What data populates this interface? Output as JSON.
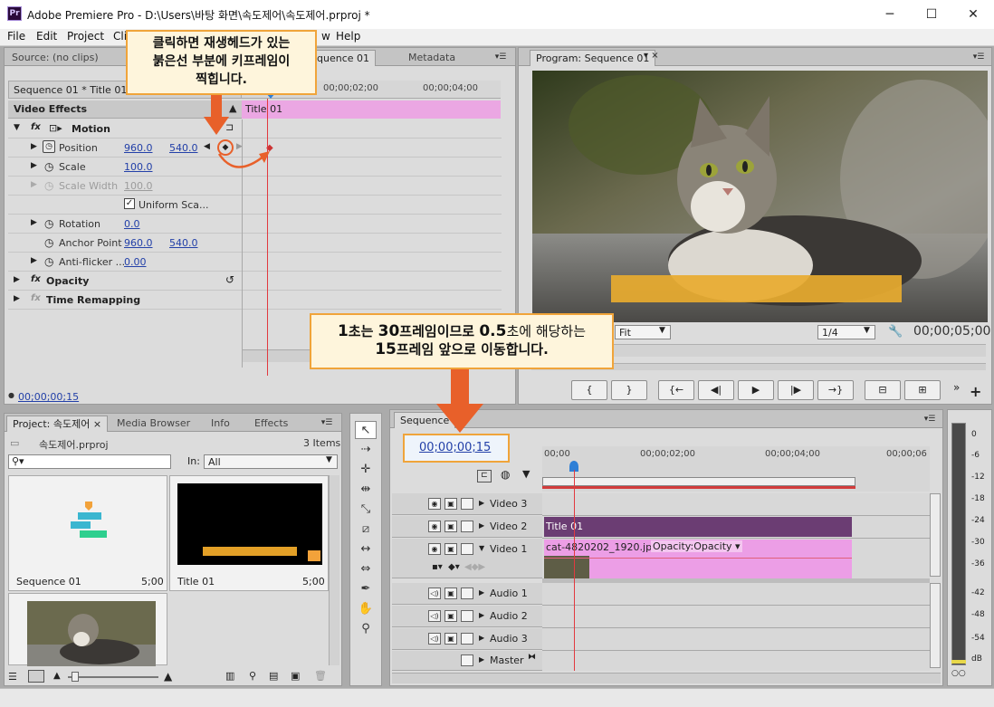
{
  "window": {
    "title": "Adobe Premiere Pro - D:\\Users\\바탕 화면\\속도제어\\속도제어.prproj *",
    "icon_text": "Pr",
    "minimize": "─",
    "maximize": "☐",
    "close": "✕"
  },
  "menu": [
    "File",
    "Edit",
    "Project",
    "Cli",
    "w",
    "Help"
  ],
  "source_panel": {
    "tabs": [
      "Source: (no clips)",
      "quence 01",
      "Metadata"
    ],
    "sequence_label": "Sequence 01 * Title 01",
    "ruler_ticks": [
      "00;00;02;00",
      "00;00;04;00"
    ],
    "clip_label": "Title 01",
    "section_title": "Video Effects",
    "effects": {
      "motion": {
        "label": "Motion"
      },
      "position": {
        "label": "Position",
        "x": "960.0",
        "y": "540.0"
      },
      "scale": {
        "label": "Scale",
        "value": "100.0"
      },
      "scale_width": {
        "label": "Scale Width",
        "value": "100.0"
      },
      "uniform_scale": {
        "label": "Uniform Sca..."
      },
      "rotation": {
        "label": "Rotation",
        "value": "0.0"
      },
      "anchor_point": {
        "label": "Anchor Point",
        "x": "960.0",
        "y": "540.0"
      },
      "anti_flicker": {
        "label": "Anti-flicker ...",
        "value": "0.00"
      },
      "opacity": {
        "label": "Opacity"
      },
      "time_remapping": {
        "label": "Time Remapping"
      }
    },
    "footer_time": "00;00;00;15"
  },
  "program_panel": {
    "tab": "Program: Sequence 01",
    "fit": "Fit",
    "resolution": "1/4",
    "timecode": "00;00;05;00",
    "transport": [
      "{",
      "}",
      "{←",
      "◀|",
      "▶",
      "|▶",
      "→}",
      "⊟",
      "⊞"
    ],
    "add": "+"
  },
  "project_panel": {
    "tabs": [
      "Project: 속도제어 ×",
      "Media Browser",
      "Info",
      "Effects"
    ],
    "file_name": "속도제어.prproj",
    "items_count": "3 Items",
    "in_label": "In:",
    "in_value": "All",
    "items": [
      {
        "name": "Sequence 01",
        "duration": "5;00"
      },
      {
        "name": "Title 01",
        "duration": "5;00"
      }
    ]
  },
  "timeline_panel": {
    "tab": "Sequence",
    "timecode": "00;00;00;15",
    "ruler_ticks": [
      "00;00",
      "00;00;02;00",
      "00;00;04;00",
      "00;00;06"
    ],
    "tracks": [
      {
        "name": "Video 3"
      },
      {
        "name": "Video 2"
      },
      {
        "name": "Video 1"
      },
      {
        "name": "Audio 1"
      },
      {
        "name": "Audio 2"
      },
      {
        "name": "Audio 3"
      },
      {
        "name": "Master"
      }
    ],
    "clip_title": "Title 01",
    "clip_image": "cat-4820202_1920.jpg",
    "clip_fx": "Opacity:Opacity ▾"
  },
  "meter_labels": [
    "0",
    "-6",
    "-12",
    "-18",
    "-24",
    "-30",
    "-36",
    "-42",
    "-48",
    "-54",
    "dB"
  ],
  "callouts": {
    "top": [
      "클릭하면 재생헤드가 있는",
      "붉은선 부분에 키프레임이",
      "찍힙니다."
    ],
    "middle_parts": [
      "1",
      "초는 ",
      "30",
      "프레임이므로 ",
      "0.5",
      "초에 해당하는"
    ],
    "middle_line2_parts": [
      "15",
      "프레임 앞으로 이동합니다."
    ]
  },
  "colors": {
    "accent_blue": "#2340a8",
    "playhead_red": "#e2393f",
    "callout_border": "#f0a43a",
    "arrow_orange": "#e8602a",
    "clip_pink": "#ec9ee6",
    "clip_purple": "#6b3d73"
  }
}
